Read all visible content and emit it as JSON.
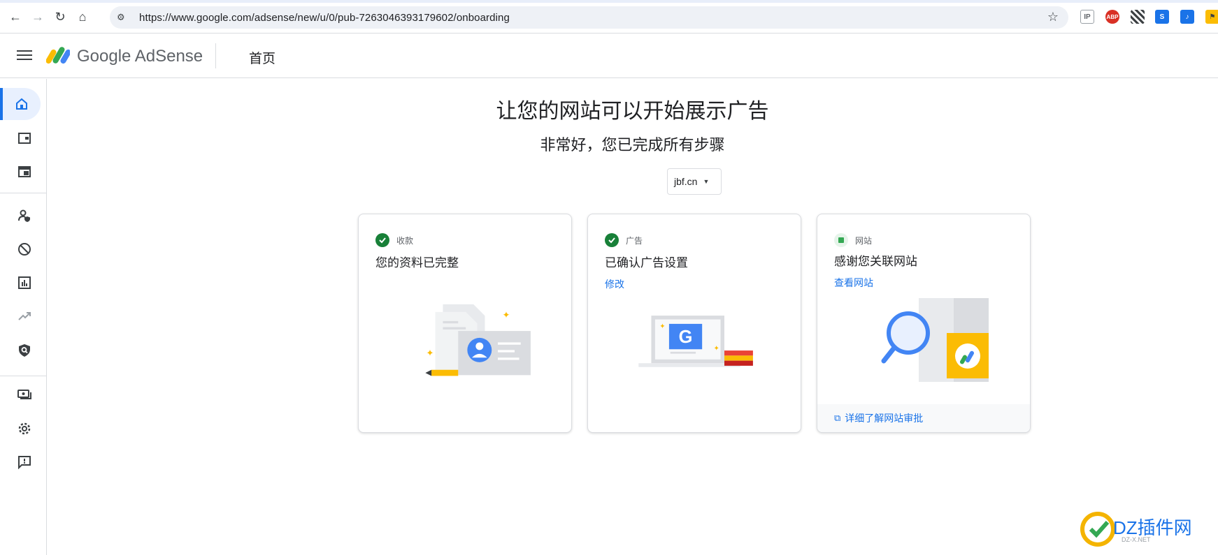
{
  "browser": {
    "url": "https://www.google.com/adsense/new/u/0/pub-7263046393179602/onboarding",
    "extensions": [
      "IP",
      "ABP"
    ]
  },
  "header": {
    "logo_google": "Google",
    "logo_product": "AdSense",
    "page_title": "首页"
  },
  "main": {
    "title": "让您的网站可以开始展示广告",
    "subtitle": "非常好，您已完成所有步骤",
    "site_select": "jbf.cn"
  },
  "cards": [
    {
      "status": "收款",
      "title": "您的资料已完整",
      "state": "done"
    },
    {
      "status": "广告",
      "title": "已确认广告设置",
      "link": "修改",
      "state": "done"
    },
    {
      "status": "网站",
      "title": "感谢您关联网站",
      "link": "查看网站",
      "footer": "详细了解网站审批",
      "state": "pending"
    }
  ],
  "watermark": {
    "text": "DZ插件网",
    "sub": "DZ-X.NET"
  },
  "colors": {
    "accent": "#1a73e8",
    "success": "#188038",
    "warning_yellow": "#fbbc04"
  }
}
